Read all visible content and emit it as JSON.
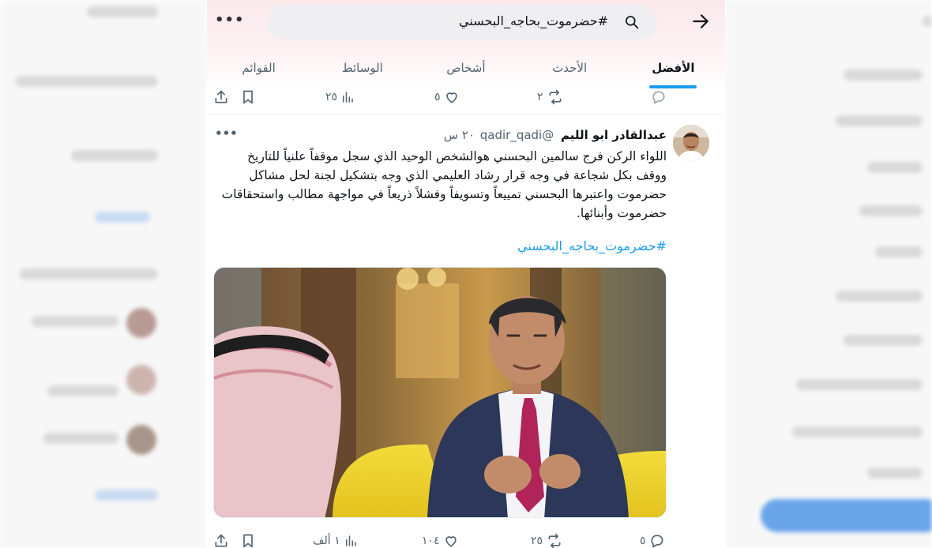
{
  "search": {
    "query": "#حضرموت_بحاجه_البحسني"
  },
  "tabs": [
    {
      "label": "الأفضل",
      "active": true
    },
    {
      "label": "الأحدث",
      "active": false
    },
    {
      "label": "أشخاص",
      "active": false
    },
    {
      "label": "الوسائط",
      "active": false
    },
    {
      "label": "القوائم",
      "active": false
    }
  ],
  "previous_tweet_actions": {
    "reply_count": "",
    "retweet_count": "٢",
    "like_count": "٥",
    "view_count": "٢٥"
  },
  "tweet": {
    "author_name": "عبدالقادر ابو الليم",
    "handle": "@qadir_qadi",
    "time": "٢٠ س",
    "text": "اللواء الركن فرج سالمين البحسني هوالشخص الوحيد الذي سجل موقفاً علنياً للتاريخ ووقف بكل شجاعة في وجه قرار رشاد العليمي الذي وجه بتشكيل لجنة لحل مشاكل حضرموت واعتبرها البحسني تمييعاً وتسويفاً وفشلاً ذريعاً في مواجهة مطالب واستحقاقات حضرموت وأبنائها.",
    "hashtag": "#حضرموت_بحاجه_البحسني",
    "actions": {
      "reply_count": "٥",
      "retweet_count": "٢٥",
      "like_count": "١٠٤",
      "view_count": "١ ألف"
    }
  },
  "colors": {
    "accent": "#1d9bf0",
    "muted": "#536471",
    "text": "#0f1419"
  }
}
